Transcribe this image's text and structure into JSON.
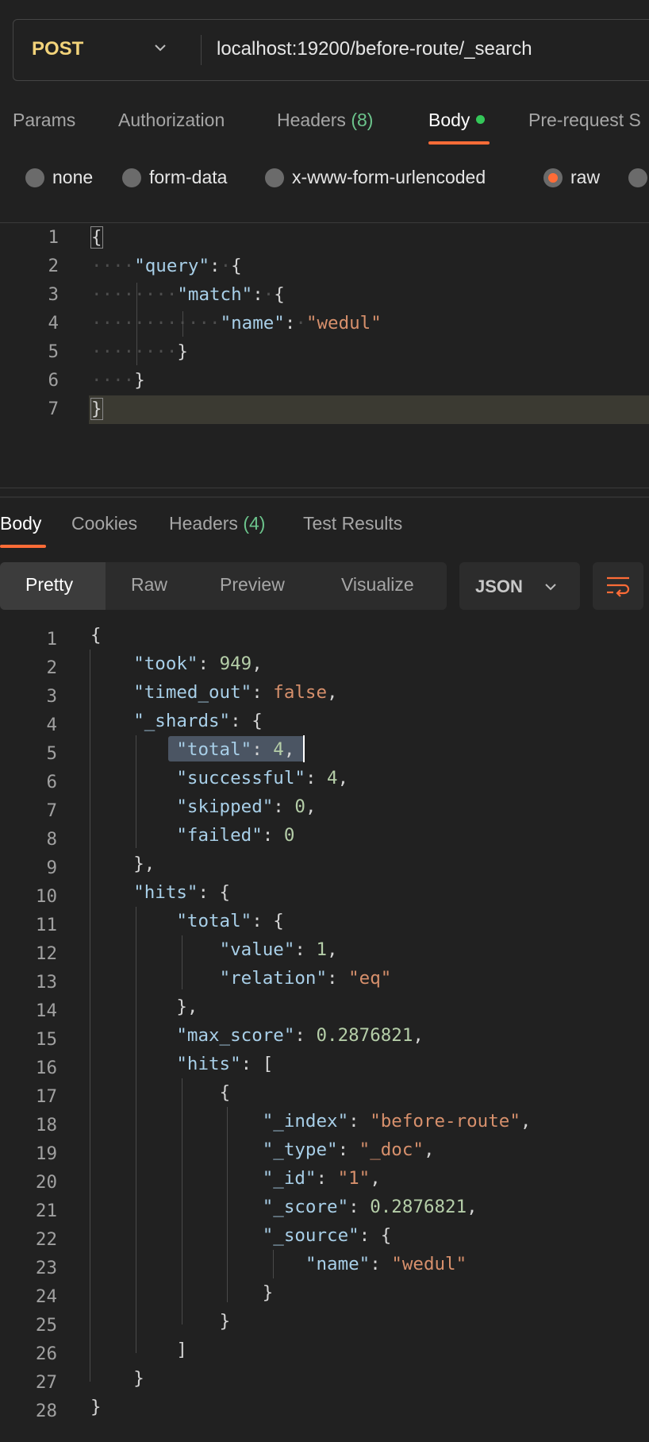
{
  "request": {
    "method": "POST",
    "url": "localhost:19200/before-route/_search"
  },
  "request_tabs": {
    "params": "Params",
    "authorization": "Authorization",
    "headers_label": "Headers",
    "headers_count": "(8)",
    "body": "Body",
    "prerequest": "Pre-request S"
  },
  "body_types": {
    "none": "none",
    "form_data": "form-data",
    "urlencoded": "x-www-form-urlencoded",
    "raw": "raw",
    "selected": "raw"
  },
  "request_body": {
    "line_numbers": [
      "1",
      "2",
      "3",
      "4",
      "5",
      "6",
      "7"
    ],
    "l1": "{",
    "l2_key": "\"query\"",
    "l3_key": "\"match\"",
    "l4_key": "\"name\"",
    "l4_val": "\"wedul\"",
    "l5": "}",
    "l6": "}",
    "l7": "}"
  },
  "response_tabs": {
    "body": "Body",
    "cookies": "Cookies",
    "headers_label": "Headers",
    "headers_count": "(4)",
    "test_results": "Test Results"
  },
  "view_modes": {
    "pretty": "Pretty",
    "raw": "Raw",
    "preview": "Preview",
    "visualize": "Visualize",
    "format": "JSON"
  },
  "response_body": {
    "took": "949",
    "timed_out": "false",
    "shards_total": "4",
    "shards_successful": "4",
    "shards_skipped": "0",
    "shards_failed": "0",
    "hits_total_value": "1",
    "hits_total_relation": "\"eq\"",
    "max_score": "0.2876821",
    "hit_index": "\"before-route\"",
    "hit_type": "\"_doc\"",
    "hit_id": "\"1\"",
    "hit_score": "0.2876821",
    "hit_source_name": "\"wedul\""
  },
  "colors": {
    "accent": "#ff6c37",
    "method": "#f2d37a",
    "count": "#6cc48c",
    "string": "#d7906c",
    "number": "#b5cea8",
    "key": "#a8cfe8"
  },
  "icons": [
    "chevron-down-icon",
    "wrap-lines-icon"
  ]
}
